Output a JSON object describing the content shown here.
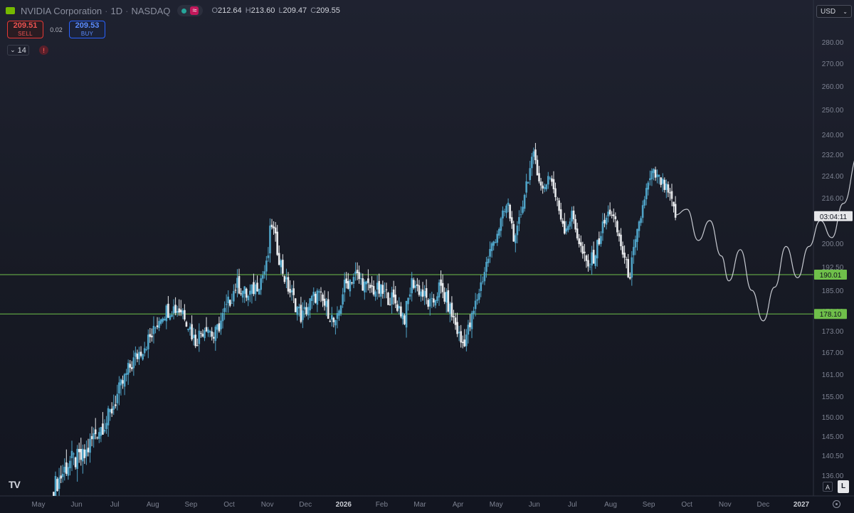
{
  "header": {
    "symbol_name": "NVIDIA Corporation",
    "interval": "1D",
    "exchange": "NASDAQ",
    "approx_label": "≈",
    "open_label": "O",
    "open": "212.64",
    "high_label": "H",
    "high": "213.60",
    "low_label": "L",
    "low": "209.47",
    "close_label": "C",
    "close": "209.55"
  },
  "trade": {
    "sell_price": "209.51",
    "sell_label": "SELL",
    "spread": "0.02",
    "buy_price": "209.53",
    "buy_label": "BUY"
  },
  "indicator": {
    "collapse_label": "14",
    "alert_label": "!"
  },
  "currency": "USD",
  "corner": {
    "logo_text": "TV",
    "auto_label": "A",
    "log_label": "L"
  },
  "colors": {
    "up_candle": "#4fa3c7",
    "down_candle": "#e8eaed",
    "horizontal_lines": "#6fbf4a",
    "projection": "#c8cbd2",
    "countdown_bg": "#e6e7ea"
  },
  "chart_data": {
    "type": "candlestick",
    "x_tick_labels": [
      "May",
      "Jun",
      "Jul",
      "Aug",
      "Sep",
      "Oct",
      "Nov",
      "Dec",
      "2026",
      "Feb",
      "Mar",
      "Apr",
      "May",
      "Jun",
      "Jul",
      "Aug",
      "Sep",
      "Oct",
      "Nov",
      "Dec",
      "2027"
    ],
    "y_tick_labels": [
      "280.00",
      "270.00",
      "260.00",
      "250.00",
      "240.00",
      "232.00",
      "224.00",
      "216.00",
      "200.00",
      "192.50",
      "185.00",
      "179.00",
      "173.00",
      "167.00",
      "161.00",
      "155.00",
      "150.00",
      "145.00",
      "140.50",
      "136.00"
    ],
    "price_ticks": [
      {
        "label": "280.00",
        "value": 280
      },
      {
        "label": "270.00",
        "value": 270
      },
      {
        "label": "260.00",
        "value": 260
      },
      {
        "label": "250.00",
        "value": 250
      },
      {
        "label": "240.00",
        "value": 240
      },
      {
        "label": "232.00",
        "value": 232
      },
      {
        "label": "224.00",
        "value": 224
      },
      {
        "label": "216.00",
        "value": 216
      },
      {
        "label": "200.00",
        "value": 200
      },
      {
        "label": "192.50",
        "value": 192.5
      },
      {
        "label": "185.00",
        "value": 185
      },
      {
        "label": "179.00",
        "value": 179
      },
      {
        "label": "173.00",
        "value": 173
      },
      {
        "label": "167.00",
        "value": 167
      },
      {
        "label": "161.00",
        "value": 161
      },
      {
        "label": "155.00",
        "value": 155
      },
      {
        "label": "150.00",
        "value": 150
      },
      {
        "label": "145.00",
        "value": 145
      },
      {
        "label": "140.50",
        "value": 140.5
      },
      {
        "label": "136.00",
        "value": 136
      }
    ],
    "horizontal_levels": [
      {
        "label": "190.01",
        "value": 190.01
      },
      {
        "label": "178.10",
        "value": 178.1
      }
    ],
    "countdown": {
      "label": "03:04:11",
      "value": 209.55
    },
    "close_path": [
      {
        "m": 0.4,
        "p": 133
      },
      {
        "m": 0.8,
        "p": 139
      },
      {
        "m": 1.2,
        "p": 140
      },
      {
        "m": 1.5,
        "p": 146
      },
      {
        "m": 1.8,
        "p": 149
      },
      {
        "m": 2.1,
        "p": 156
      },
      {
        "m": 2.4,
        "p": 163
      },
      {
        "m": 2.7,
        "p": 168
      },
      {
        "m": 3.0,
        "p": 172
      },
      {
        "m": 3.2,
        "p": 178
      },
      {
        "m": 3.5,
        "p": 180
      },
      {
        "m": 3.8,
        "p": 179
      },
      {
        "m": 4.1,
        "p": 170
      },
      {
        "m": 4.4,
        "p": 175
      },
      {
        "m": 4.6,
        "p": 171
      },
      {
        "m": 4.9,
        "p": 179
      },
      {
        "m": 5.2,
        "p": 187
      },
      {
        "m": 5.5,
        "p": 183
      },
      {
        "m": 5.8,
        "p": 188
      },
      {
        "m": 6.0,
        "p": 193
      },
      {
        "m": 6.1,
        "p": 208
      },
      {
        "m": 6.3,
        "p": 196
      },
      {
        "m": 6.5,
        "p": 187
      },
      {
        "m": 6.7,
        "p": 182
      },
      {
        "m": 6.9,
        "p": 177
      },
      {
        "m": 7.1,
        "p": 181
      },
      {
        "m": 7.3,
        "p": 184
      },
      {
        "m": 7.6,
        "p": 179
      },
      {
        "m": 7.8,
        "p": 174
      },
      {
        "m": 8.0,
        "p": 186
      },
      {
        "m": 8.3,
        "p": 190
      },
      {
        "m": 8.6,
        "p": 186
      },
      {
        "m": 8.9,
        "p": 185
      },
      {
        "m": 9.2,
        "p": 183
      },
      {
        "m": 9.4,
        "p": 181
      },
      {
        "m": 9.6,
        "p": 177
      },
      {
        "m": 9.8,
        "p": 188
      },
      {
        "m": 10.0,
        "p": 185
      },
      {
        "m": 10.3,
        "p": 180
      },
      {
        "m": 10.5,
        "p": 186
      },
      {
        "m": 10.7,
        "p": 182
      },
      {
        "m": 10.9,
        "p": 176
      },
      {
        "m": 11.1,
        "p": 169
      },
      {
        "m": 11.3,
        "p": 174
      },
      {
        "m": 11.6,
        "p": 187
      },
      {
        "m": 11.8,
        "p": 196
      },
      {
        "m": 12.0,
        "p": 203
      },
      {
        "m": 12.3,
        "p": 214
      },
      {
        "m": 12.5,
        "p": 200
      },
      {
        "m": 12.8,
        "p": 222
      },
      {
        "m": 13.0,
        "p": 232
      },
      {
        "m": 13.2,
        "p": 218
      },
      {
        "m": 13.4,
        "p": 225
      },
      {
        "m": 13.6,
        "p": 214
      },
      {
        "m": 13.8,
        "p": 205
      },
      {
        "m": 14.0,
        "p": 210
      },
      {
        "m": 14.2,
        "p": 199
      },
      {
        "m": 14.4,
        "p": 192
      },
      {
        "m": 14.6,
        "p": 197
      },
      {
        "m": 14.8,
        "p": 206
      },
      {
        "m": 15.0,
        "p": 212
      },
      {
        "m": 15.2,
        "p": 203
      },
      {
        "m": 15.4,
        "p": 193
      },
      {
        "m": 15.5,
        "p": 190
      },
      {
        "m": 15.7,
        "p": 203
      },
      {
        "m": 15.9,
        "p": 217
      },
      {
        "m": 16.1,
        "p": 225
      },
      {
        "m": 16.3,
        "p": 222
      },
      {
        "m": 16.5,
        "p": 218
      },
      {
        "m": 16.7,
        "p": 210
      }
    ],
    "projection_path": [
      {
        "m": 16.7,
        "p": 210
      },
      {
        "m": 17.0,
        "p": 212
      },
      {
        "m": 17.3,
        "p": 201
      },
      {
        "m": 17.6,
        "p": 208
      },
      {
        "m": 17.9,
        "p": 196
      },
      {
        "m": 18.1,
        "p": 188
      },
      {
        "m": 18.4,
        "p": 198
      },
      {
        "m": 18.7,
        "p": 185
      },
      {
        "m": 19.0,
        "p": 176
      },
      {
        "m": 19.3,
        "p": 186
      },
      {
        "m": 19.6,
        "p": 199
      },
      {
        "m": 19.9,
        "p": 189
      },
      {
        "m": 20.2,
        "p": 199
      },
      {
        "m": 20.5,
        "p": 208
      },
      {
        "m": 20.8,
        "p": 202
      },
      {
        "m": 21.1,
        "p": 214
      },
      {
        "m": 21.5,
        "p": 232
      },
      {
        "m": 21.8,
        "p": 250
      }
    ]
  }
}
